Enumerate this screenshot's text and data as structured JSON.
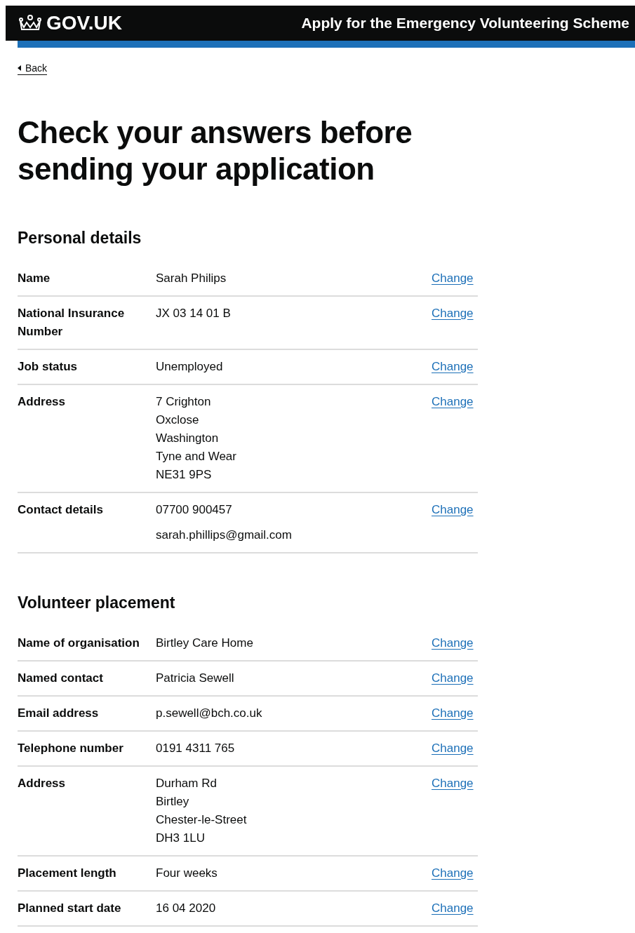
{
  "header": {
    "logo": "GOV.UK",
    "service_name": "Apply for the Emergency Volunteering Scheme"
  },
  "back_link": "Back",
  "title": "Check your answers before sending your application",
  "sections": [
    {
      "heading": "Personal details",
      "rows": [
        {
          "key": "Name",
          "kind": "lines",
          "value": [
            "Sarah Philips"
          ],
          "action": "Change"
        },
        {
          "key": "National Insurance Number",
          "kind": "lines",
          "value": [
            "JX 03 14 01 B"
          ],
          "action": "Change"
        },
        {
          "key": "Job status",
          "kind": "lines",
          "value": [
            "Unemployed"
          ],
          "action": "Change"
        },
        {
          "key": "Address",
          "kind": "lines",
          "value": [
            "7 Crighton",
            "Oxclose",
            "Washington",
            "Tyne and Wear",
            "NE31 9PS"
          ],
          "action": "Change"
        },
        {
          "key": "Contact details",
          "kind": "paragraphs",
          "value": [
            "07700 900457",
            "sarah.phillips@gmail.com"
          ],
          "action": "Change"
        }
      ]
    },
    {
      "heading": "Volunteer placement",
      "rows": [
        {
          "key": "Name of organisation",
          "kind": "lines",
          "value": [
            "Birtley Care Home"
          ],
          "action": "Change"
        },
        {
          "key": "Named contact",
          "kind": "lines",
          "value": [
            "Patricia Sewell"
          ],
          "action": "Change"
        },
        {
          "key": "Email address",
          "kind": "lines",
          "value": [
            "p.sewell@bch.co.uk"
          ],
          "action": "Change"
        },
        {
          "key": "Telephone number",
          "kind": "lines",
          "value": [
            "0191 4311 765"
          ],
          "action": "Change"
        },
        {
          "key": "Address",
          "kind": "lines",
          "value": [
            "Durham Rd",
            "Birtley",
            "Chester-le-Street",
            "DH3 1LU"
          ],
          "action": "Change"
        },
        {
          "key": "Placement length",
          "kind": "lines",
          "value": [
            "Four weeks"
          ],
          "action": "Change"
        },
        {
          "key": "Planned start date",
          "kind": "lines",
          "value": [
            "16 04 2020"
          ],
          "action": "Change"
        }
      ]
    }
  ]
}
